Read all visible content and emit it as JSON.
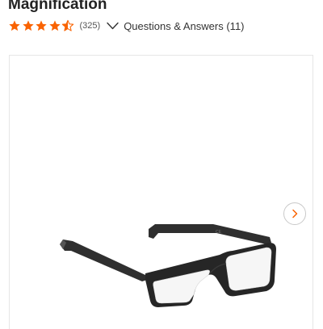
{
  "product": {
    "title": "Magnification",
    "image_alt": "Black rectangular reading glasses"
  },
  "rating": {
    "stars": 4.5,
    "max_stars": 5,
    "review_count": "(325)",
    "star_color": "#f96302"
  },
  "qa": {
    "label": "Questions & Answers (11)"
  },
  "icons": {
    "star": "star-icon",
    "chevron_down": "chevron-down-icon",
    "chevron_right": "chevron-right-icon"
  },
  "colors": {
    "accent": "#f96302",
    "panel_border": "#e6e6e6",
    "frame": "#2a2a2a"
  }
}
